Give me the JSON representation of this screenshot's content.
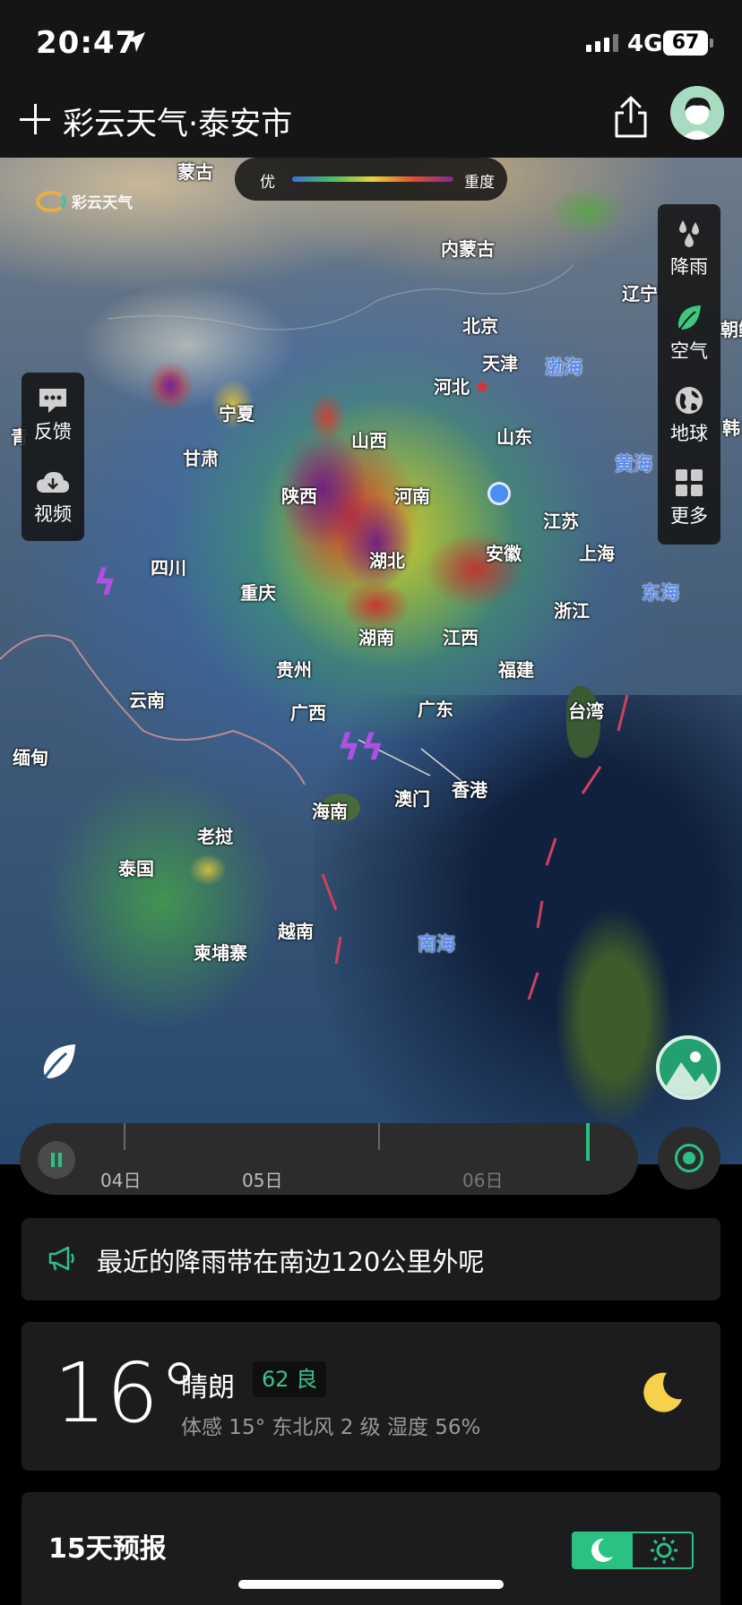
{
  "status_bar": {
    "time": "20:47",
    "network": "4G",
    "battery": "67"
  },
  "header": {
    "title": "彩云天气·泰安市"
  },
  "map": {
    "logo_text": "彩云天气",
    "legend": {
      "left": "优",
      "right": "重度"
    },
    "labels": {
      "mongolia": "蒙古",
      "inner_mongolia": "内蒙古",
      "liaoning": "辽宁",
      "beijing": "北京",
      "tianjin": "天津",
      "hebei": "河北",
      "ningxia": "宁夏",
      "shanxi": "山西",
      "shandong": "山东",
      "gansu": "甘肃",
      "shaanxi": "陕西",
      "henan": "河南",
      "jiangsu": "江苏",
      "sichuan": "四川",
      "hubei": "湖北",
      "anhui": "安徽",
      "shanghai": "上海",
      "chongqing": "重庆",
      "zhejiang": "浙江",
      "hunan": "湖南",
      "jiangxi": "江西",
      "guizhou": "贵州",
      "fujian": "福建",
      "yunnan": "云南",
      "guangxi": "广西",
      "guangdong": "广东",
      "taiwan": "台湾",
      "myanmar": "缅甸",
      "macau": "澳门",
      "hongkong": "香港",
      "hainan": "海南",
      "laos": "老挝",
      "thailand": "泰国",
      "vietnam": "越南",
      "cambodia": "柬埔寨",
      "korea_partial": "朝鲜",
      "sk_partial": "韩",
      "qinghai_partial": "青"
    },
    "seas": {
      "bohai": "渤海",
      "yellow_sea": "黄海",
      "east_sea": "东海",
      "south_sea": "南海"
    },
    "left_panel": {
      "feedback": "反馈",
      "video": "视频"
    },
    "right_panel": {
      "rain": "降雨",
      "air": "空气",
      "globe": "地球",
      "more": "更多"
    },
    "active_layer": "空气"
  },
  "timeline": {
    "labels": [
      "04日",
      "05日",
      "06日"
    ]
  },
  "notice": {
    "text": "最近的降雨带在南边120公里外呢"
  },
  "weather": {
    "temperature": "16°",
    "condition": "晴朗",
    "aqi": "62 良",
    "details": "体感 15°  东北风 2 级  湿度 56%"
  },
  "forecast": {
    "title": "15天预报"
  },
  "colors": {
    "accent": "#29c283",
    "aqi_good": "#37c48a",
    "moon": "#f5d24a"
  }
}
